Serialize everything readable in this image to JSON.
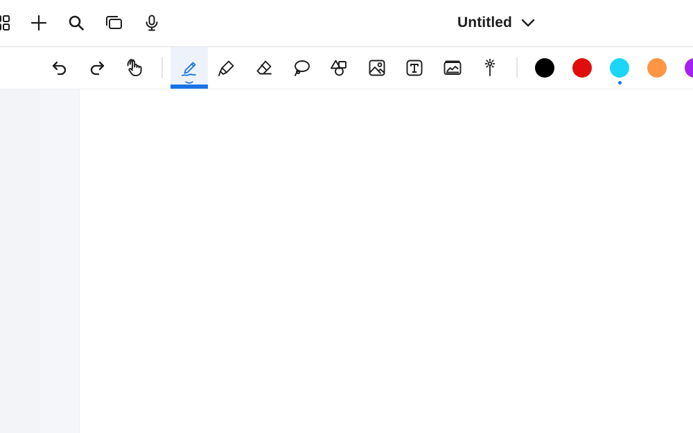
{
  "document": {
    "title": "Untitled"
  },
  "topbar": {
    "icons": [
      "grid-icon",
      "plus-icon",
      "search-icon",
      "pages-icon",
      "microphone-icon",
      "chevron-down-icon"
    ]
  },
  "toolbar": {
    "tools": [
      {
        "name": "undo",
        "icon": "undo-icon"
      },
      {
        "name": "redo",
        "icon": "redo-icon"
      },
      {
        "name": "hand",
        "icon": "hand-pointer-icon"
      },
      {
        "name": "pen",
        "icon": "pen-icon",
        "active": true
      },
      {
        "name": "highlighter",
        "icon": "highlighter-icon"
      },
      {
        "name": "eraser",
        "icon": "eraser-icon"
      },
      {
        "name": "lasso",
        "icon": "lasso-icon"
      },
      {
        "name": "shapes",
        "icon": "shapes-icon"
      },
      {
        "name": "image",
        "icon": "image-icon"
      },
      {
        "name": "text",
        "icon": "text-box-icon"
      },
      {
        "name": "sticker",
        "icon": "sticker-icon"
      },
      {
        "name": "laser",
        "icon": "laser-pointer-icon"
      }
    ],
    "colors": [
      {
        "name": "black",
        "hex": "#000000"
      },
      {
        "name": "red",
        "hex": "#e00d0d"
      },
      {
        "name": "cyan",
        "hex": "#1bd6f7",
        "selected": true
      },
      {
        "name": "orange",
        "hex": "#ff9644"
      },
      {
        "name": "purple",
        "hex": "#a422f2"
      }
    ],
    "accent_color": "#1a73e8"
  }
}
